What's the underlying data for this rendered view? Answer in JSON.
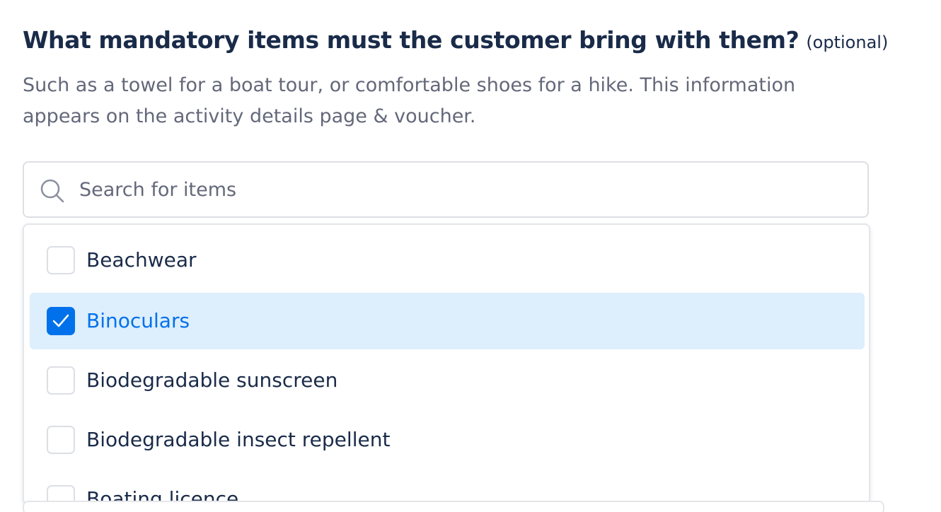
{
  "question": {
    "title": "What mandatory items must the customer bring with them?",
    "optional_label": "(optional)",
    "help_text": "Such as a towel for a boat tour, or comfortable shoes for a hike. This information appears on the activity details page & voucher."
  },
  "search": {
    "placeholder": "Search for items",
    "value": "",
    "icon": "search-icon"
  },
  "options": [
    {
      "label": "Beachwear",
      "checked": false
    },
    {
      "label": "Binoculars",
      "checked": true
    },
    {
      "label": "Biodegradable sunscreen",
      "checked": false
    },
    {
      "label": "Biodegradable insect repellent",
      "checked": false
    },
    {
      "label": "Boating licence",
      "checked": false
    }
  ],
  "colors": {
    "heading": "#1a2b49",
    "muted_text": "#63687a",
    "accent": "#0071eb",
    "selected_row_bg": "#ddeefc",
    "border": "#dcdfe4"
  }
}
